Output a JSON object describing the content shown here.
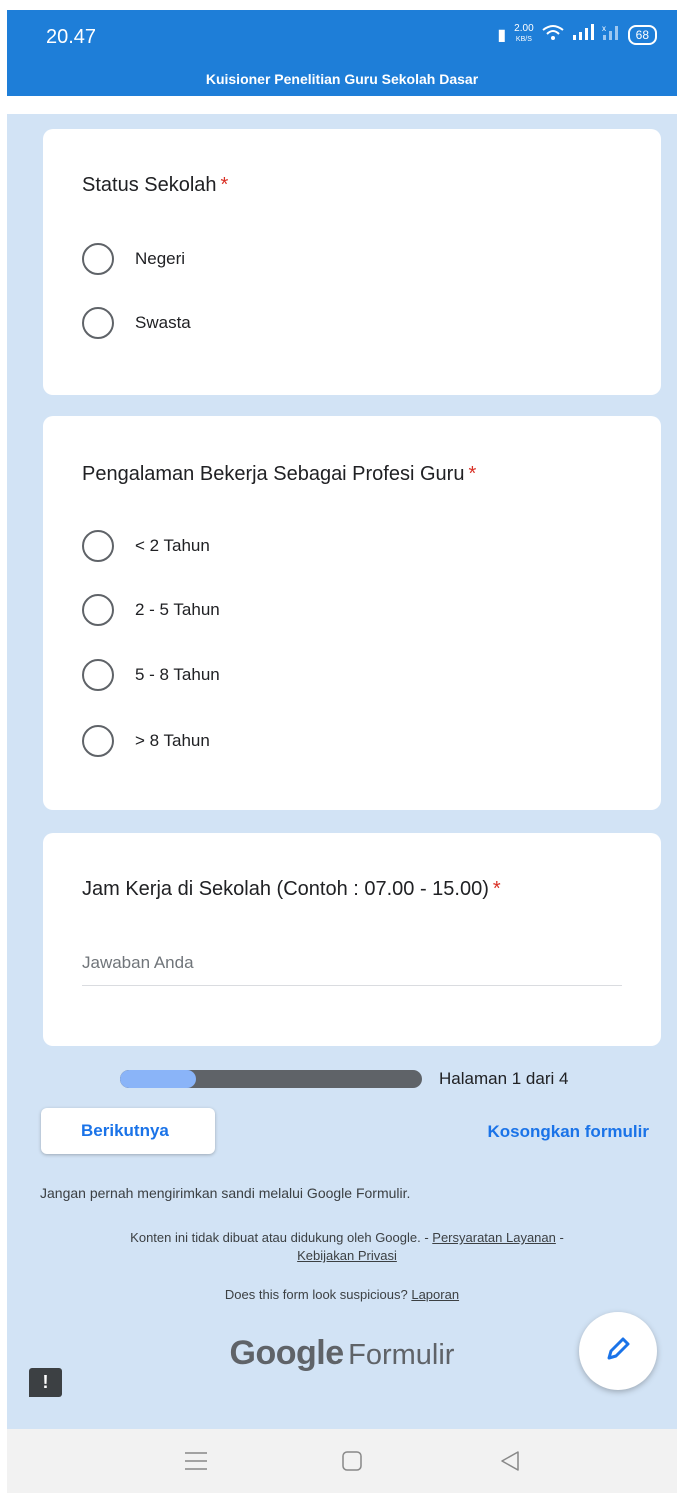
{
  "status_bar": {
    "time": "20.47",
    "network_speed": "2.00",
    "network_unit": "KB/S",
    "battery": "68"
  },
  "app": {
    "title": "Kuisioner Penelitian Guru Sekolah Dasar"
  },
  "questions": [
    {
      "title": "Status Sekolah",
      "required_mark": "*",
      "options": [
        "Negeri",
        "Swasta"
      ]
    },
    {
      "title": "Pengalaman Bekerja Sebagai Profesi Guru",
      "required_mark": "*",
      "options": [
        "< 2 Tahun",
        "2 - 5 Tahun",
        "5 - 8 Tahun",
        "> 8 Tahun"
      ]
    },
    {
      "title": "Jam Kerja di Sekolah (Contoh : 07.00 - 15.00)",
      "required_mark": "*",
      "placeholder": "Jawaban Anda"
    }
  ],
  "progress": {
    "page_label": "Halaman 1 dari 4",
    "fraction": 0.25
  },
  "actions": {
    "next_label": "Berikutnya",
    "clear_label": "Kosongkan formulir"
  },
  "footer": {
    "warning": "Jangan pernah mengirimkan sandi melalui Google Formulir.",
    "disclaimer_prefix": "Konten ini tidak dibuat atau didukung oleh Google. - ",
    "terms_link": "Persyaratan Layanan",
    "separator": " - ",
    "privacy_link": "Kebijakan Privasi",
    "suspicious_text": "Does this form look suspicious? ",
    "report_link": "Laporan",
    "brand_google": "Google",
    "brand_forms": "Formulir"
  },
  "colors": {
    "header": "#1e7ed8",
    "page_bg": "#d2e3f5",
    "accent": "#1a73e8",
    "required": "#d93025",
    "progress_fill": "#8ab4f8",
    "progress_track": "#5f6368"
  }
}
